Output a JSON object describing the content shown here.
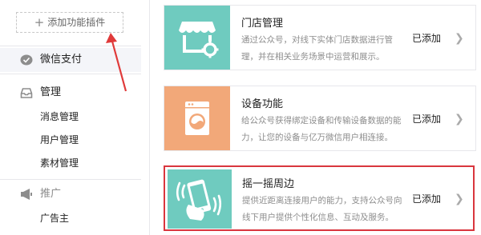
{
  "sidebar": {
    "add_plugin_label": "添加功能插件",
    "wechat_pay_label": "微信支付",
    "manage_section": {
      "label": "管理",
      "items": [
        "消息管理",
        "用户管理",
        "素材管理"
      ]
    },
    "promo_section": {
      "label": "推广",
      "items": [
        "广告主"
      ]
    }
  },
  "plugins": [
    {
      "title": "门店管理",
      "desc": "通过公众号，对线下实体门店数据进行管理，并在相关业务场景中运营和展示。",
      "status": "已添加",
      "icon": "store-awning-gear-icon",
      "color": "#6fcbbf"
    },
    {
      "title": "设备功能",
      "desc": "给公众号获得绑定设备和传输设备数据的能力，让您的设备与亿万微信用户相连接。",
      "status": "已添加",
      "icon": "washing-machine-icon",
      "color": "#f2a879"
    },
    {
      "title": "摇一摇周边",
      "desc": "提供近距离连接用户的能力，支持公众号向线下用户提供个性化信息、互动及服务。",
      "status": "已添加",
      "icon": "shaking-phone-hand-icon",
      "color": "#6fcbbf"
    }
  ],
  "colors": {
    "teal": "#6fcbbf",
    "orange": "#f2a879",
    "highlight_red": "#d9363e"
  }
}
